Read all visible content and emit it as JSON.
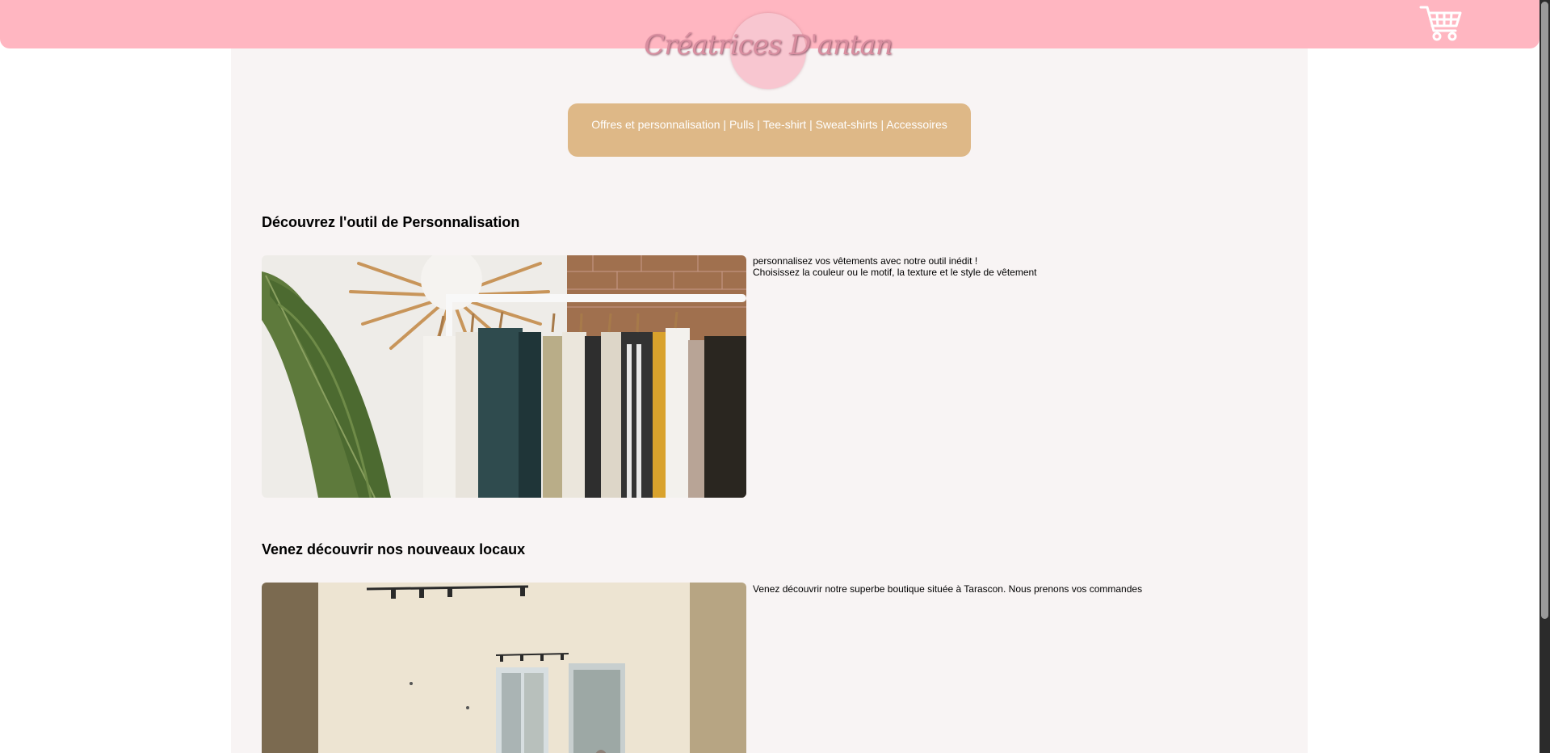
{
  "header": {
    "logo_text": "Créatrices D'antan",
    "cart_icon": "shopping-cart-icon",
    "bar_color": "#ffb6c1"
  },
  "nav": {
    "items": [
      "Offres et personnalisation",
      "Pulls",
      "Tee-shirt",
      "Sweat-shirts",
      "Accessoires"
    ],
    "separator": "|",
    "box_color": "#deb887"
  },
  "sections": [
    {
      "title": "Découvrez l'outil de Personnalisation",
      "description_lines": [
        "personnalisez vos vêtements avec notre outil inédit !",
        "Choisissez la couleur ou le motif, la texture et le style de vêtement"
      ]
    },
    {
      "title": "Venez découvrir nos nouveaux locaux",
      "description_lines": [
        "Venez découvrir notre superbe boutique située à Tarascon. Nous prenons vos commandes"
      ]
    }
  ],
  "colors": {
    "content_bg": "#f8f4f4",
    "text": "#000000"
  }
}
